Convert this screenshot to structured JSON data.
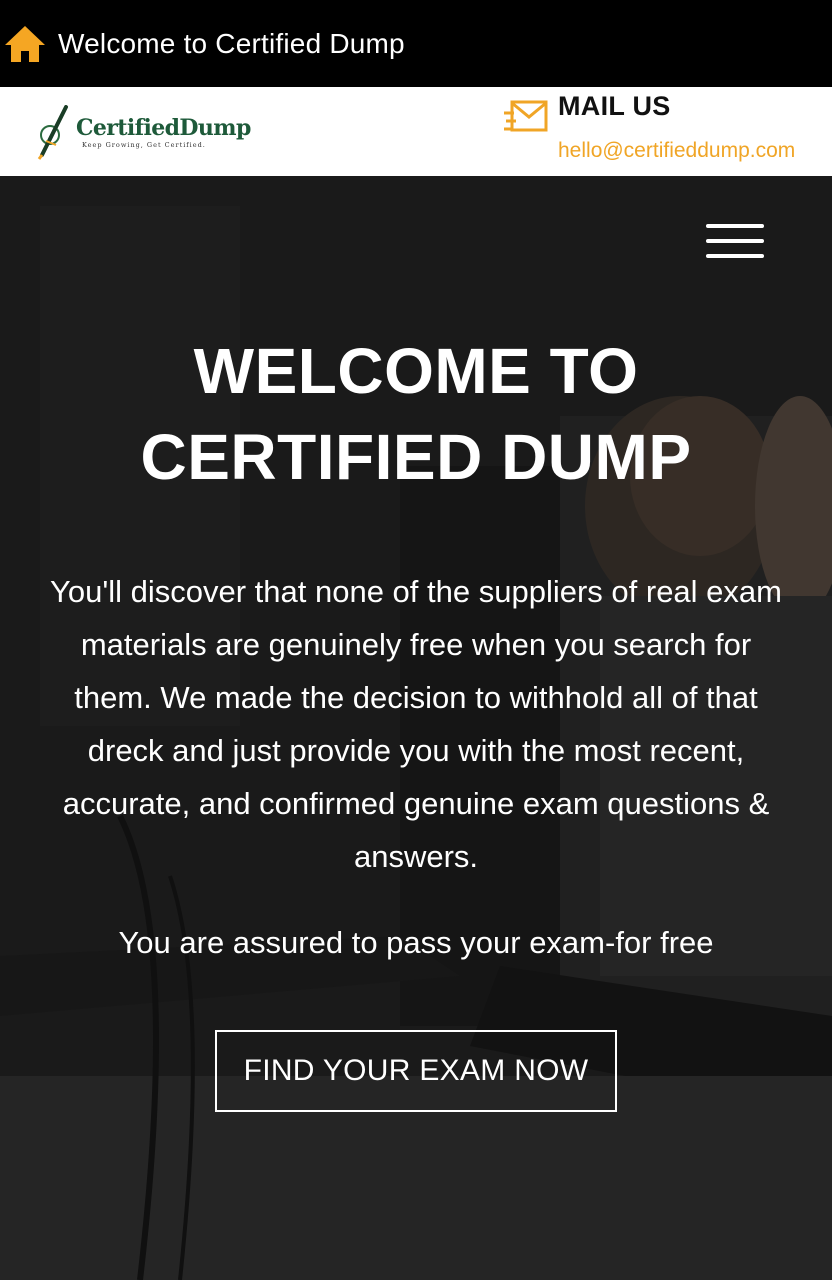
{
  "appbar": {
    "title": "Welcome to Certified Dump",
    "icon": "home-icon",
    "icon_color": "#f5a623"
  },
  "header": {
    "logo_text": "CertifiedDump",
    "logo_tagline": "Keep Growing, Get Certified.",
    "mail_label": "MAIL US",
    "mail_address": "hello@certifieddump.com",
    "mail_icon": "envelope-icon",
    "accent_color": "#f0a526"
  },
  "hero": {
    "menu_icon": "hamburger-menu-icon",
    "title": "WELCOME TO CERTIFIED DUMP",
    "description": "You'll discover that none of the suppliers of real exam materials are genuinely free when you search for them. We made the decision to withhold all of that dreck and just provide you with the most recent, accurate, and confirmed genuine exam questions & answers.",
    "subtitle": "You are assured to pass your exam-for free",
    "cta_label": "FIND YOUR EXAM NOW"
  }
}
